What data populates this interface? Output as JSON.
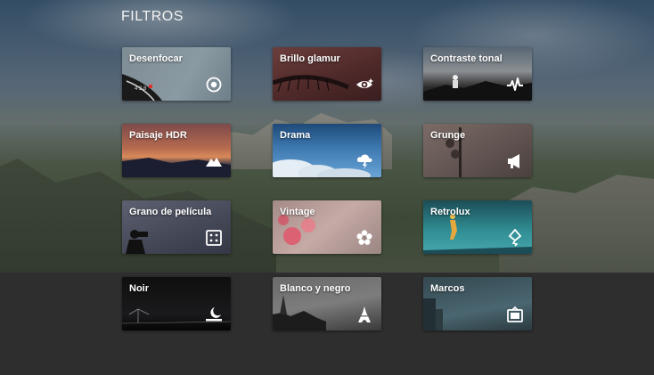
{
  "header": {
    "title": "FILTROS"
  },
  "tiles": [
    {
      "label": "Desenfocar",
      "icon": "target-icon"
    },
    {
      "label": "Brillo glamur",
      "icon": "eye-sparkle-icon"
    },
    {
      "label": "Contraste tonal",
      "icon": "pulse-icon"
    },
    {
      "label": "Paisaje HDR",
      "icon": "mountain-icon"
    },
    {
      "label": "Drama",
      "icon": "cloud-bolt-icon"
    },
    {
      "label": "Grunge",
      "icon": "megaphone-icon"
    },
    {
      "label": "Grano de película",
      "icon": "grain-dots-icon"
    },
    {
      "label": "Vintage",
      "icon": "flower-icon"
    },
    {
      "label": "Retrolux",
      "icon": "kite-icon"
    },
    {
      "label": "Noir",
      "icon": "moon-horizon-icon"
    },
    {
      "label": "Blanco y negro",
      "icon": "eiffel-tower-icon"
    },
    {
      "label": "Marcos",
      "icon": "frame-icon"
    }
  ],
  "colors": {
    "bottom_band": "#2e2e2e",
    "text": "#ffffff"
  }
}
